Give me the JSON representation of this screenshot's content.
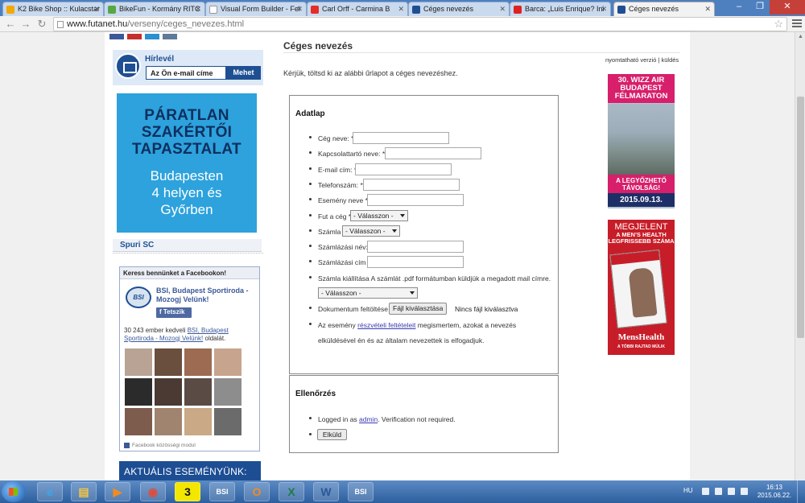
{
  "browser": {
    "tabs": [
      {
        "title": "K2 Bike Shop :: Kulacstar",
        "favicon_color": "#f2a900"
      },
      {
        "title": "BikeFun - Kormány RITC",
        "favicon_color": "#57a845"
      },
      {
        "title": "Visual Form Builder - Fel",
        "favicon_color": "#ffffff"
      },
      {
        "title": "Carl Orff - Carmina B",
        "favicon_color": "#e52d27"
      },
      {
        "title": "Céges nevezés",
        "favicon_color": "#1f4f93"
      },
      {
        "title": "Barca: „Luis Enrique? Ini",
        "favicon_color": "#d22"
      },
      {
        "title": "Céges nevezés",
        "favicon_color": "#1f4f93"
      }
    ],
    "url_host": "www.futanet.hu",
    "url_path": "/verseny/ceges_nevezes.html"
  },
  "sidebar": {
    "newsletter_title": "Hírlevél",
    "email_placeholder": "Az Ön e-mail címe",
    "newsletter_button": "Mehet",
    "ad_headline": [
      "PÁRATLAN",
      "SZAKÉRTŐI",
      "TAPASZTALAT"
    ],
    "ad_body": [
      "Budapesten",
      "4 helyen és",
      "Győrben"
    ],
    "section_title": "Spuri SC",
    "facebook": {
      "header": "Keress bennünket a Facebookon!",
      "logo_text": "BSI",
      "page_name": "BSI, Budapest Sportiroda - Mozogj Velünk!",
      "like_button": "Tetszik",
      "count_prefix": "30 243 ember kedveli ",
      "count_link": "BSI, Budapest Sportiroda - Mozogj Velünk!",
      "count_suffix": " oldalát.",
      "footer": "Facebook közösségi modul",
      "avatar_colors": [
        "#b8a394",
        "#6a4e3e",
        "#9c6b52",
        "#c7a48e",
        "#2b2b2b",
        "#4a3a33",
        "#5a4c45",
        "#8d8d8d",
        "#7d5c4d",
        "#a0846f",
        "#c9a986",
        "#6b6b6b"
      ]
    },
    "event_banner": "AKTUÁLIS ESEMÉNYÜNK:"
  },
  "main": {
    "title": "Céges nevezés",
    "print_version": "nyomtatható verzió",
    "send": "küldés",
    "intro": "Kérjük, töltsd ki az alábbi űrlapot a céges nevezéshez.",
    "form_legend": "Adatlap",
    "fields": [
      {
        "label": "Cég neve: *"
      },
      {
        "label": "Kapcsolattartó neve: *"
      },
      {
        "label": "E-mail cím: *"
      },
      {
        "label": "Telefonszám: *"
      },
      {
        "label": "Esemény neve *"
      }
    ],
    "run_company_label": "Fut a cég *",
    "run_company_value": "- Válasszon -",
    "invoice_label": "Számla",
    "invoice_value": "- Válasszon -",
    "billing_name_label": "Számlázási név:",
    "billing_address_label": "Számlázási cím",
    "invoice_issue_label": "Számla kiállítása A számlát .pdf formátumban küldjük a megadott mail címre.",
    "invoice_issue_value": "- Válasszon -",
    "upload_label": "Dokumentum feltöltése",
    "upload_button": "Fájl kiválasztása",
    "upload_status": "Nincs fájl kiválasztva",
    "terms_prefix": "Az esemény ",
    "terms_link": "részvételi feltételeit",
    "terms_suffix": " megismertem, azokat a nevezés",
    "terms_line2": "elküldésével én és az általam nevezettek is elfogadjuk.",
    "verify_legend": "Ellenőrzés",
    "logged_prefix": "Logged in as ",
    "logged_user": "admin",
    "logged_suffix": ". Verification not required.",
    "submit": "Elküld"
  },
  "ads_right": {
    "race_head": [
      "30. WIZZ AIR",
      "BUDAPEST",
      "FÉLMARATON"
    ],
    "race_slogan": [
      "A LEGYŐZHETŐ",
      "TÁVOLSÁG!"
    ],
    "race_date": "2015.09.13.",
    "mag_head": "MEGJELENT",
    "mag_sub": [
      "A MEN'S HEALTH",
      "LEGFRISSEBB SZÁMA"
    ],
    "mag_logo": "MensHealth",
    "mag_foot": "A TÖBBI RAJTAD MÚLIK"
  },
  "taskbar": {
    "apps": [
      "ie",
      "explorer",
      "media-player",
      "chrome",
      "3",
      "bsi",
      "outlook",
      "excel",
      "word",
      "bsi"
    ],
    "language": "HU",
    "time": "16:13",
    "date": "2015.06.22."
  }
}
